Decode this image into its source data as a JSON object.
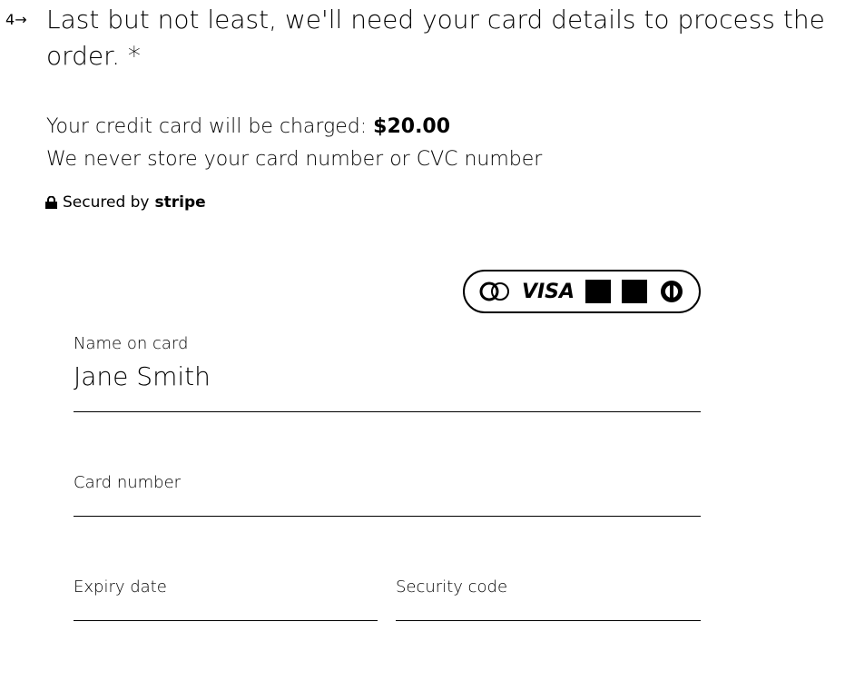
{
  "question": {
    "number": "4",
    "arrow": "→",
    "title": "Last but not least, we'll need your card details to process the order. *"
  },
  "charge": {
    "label": "Your credit card will be charged:",
    "amount": "$20.00",
    "note": "We never store your card number or CVC number"
  },
  "secured": {
    "text": "Secured by",
    "brand": "stripe"
  },
  "cards": {
    "visa": "VISA"
  },
  "form": {
    "name": {
      "label": "Name on card",
      "value": "Jane Smith"
    },
    "card_number": {
      "label": "Card number",
      "value": ""
    },
    "expiry": {
      "label": "Expiry date",
      "value": ""
    },
    "cvc": {
      "label": "Security code",
      "value": ""
    }
  }
}
